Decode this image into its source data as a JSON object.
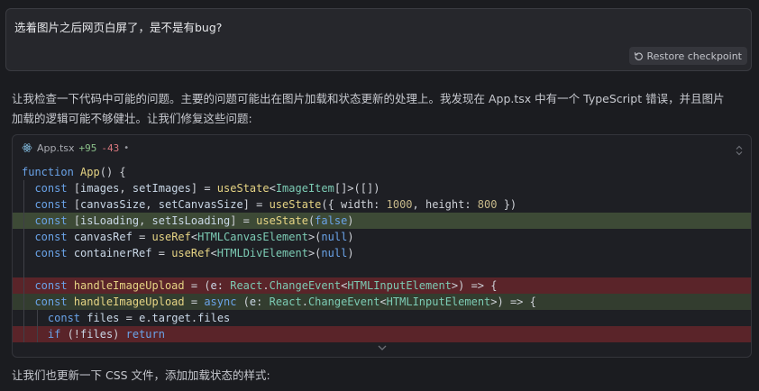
{
  "user_message": {
    "text": "选着图片之后网页白屏了，是不是有bug?",
    "restore_label": "Restore checkpoint"
  },
  "assistant": {
    "intro_line1": "让我检查一下代码中可能的问题。主要的问题可能出在图片加载和状态更新的处理上。我发现在 App.tsx 中有一个 TypeScript 错误，并且图片",
    "intro_line2": "加载的逻辑可能不够健壮。让我们修复这些问题:",
    "footer": "让我们也更新一下 CSS 文件，添加加载状态的样式:"
  },
  "code_block": {
    "file_name": "App.tsx",
    "added": "+95",
    "removed": "-43",
    "dot": "•",
    "icons": {
      "file": "react-icon",
      "expand": "expand-icon",
      "more": "chevron-down-icon",
      "restore": "restore-icon"
    },
    "lines": [
      "function App() {",
      "  const [images, setImages] = useState<ImageItem[]>([])",
      "  const [canvasSize, setCanvasSize] = useState({ width: 1000, height: 800 })",
      "  const [isLoading, setIsLoading] = useState(false)",
      "  const canvasRef = useRef<HTMLCanvasElement>(null)",
      "  const containerRef = useRef<HTMLDivElement>(null)",
      "",
      "  const handleImageUpload = (e: React.ChangeEvent<HTMLInputElement>) => {",
      "  const handleImageUpload = async (e: React.ChangeEvent<HTMLInputElement>) => {",
      "    const files = e.target.files",
      "    if (!files) return"
    ]
  },
  "colors": {
    "background": "#1b1c20",
    "added_line": "#3d4a36",
    "removed_line": "#5a2429",
    "added_count": "#8bc08a",
    "removed_count": "#d9777e"
  }
}
